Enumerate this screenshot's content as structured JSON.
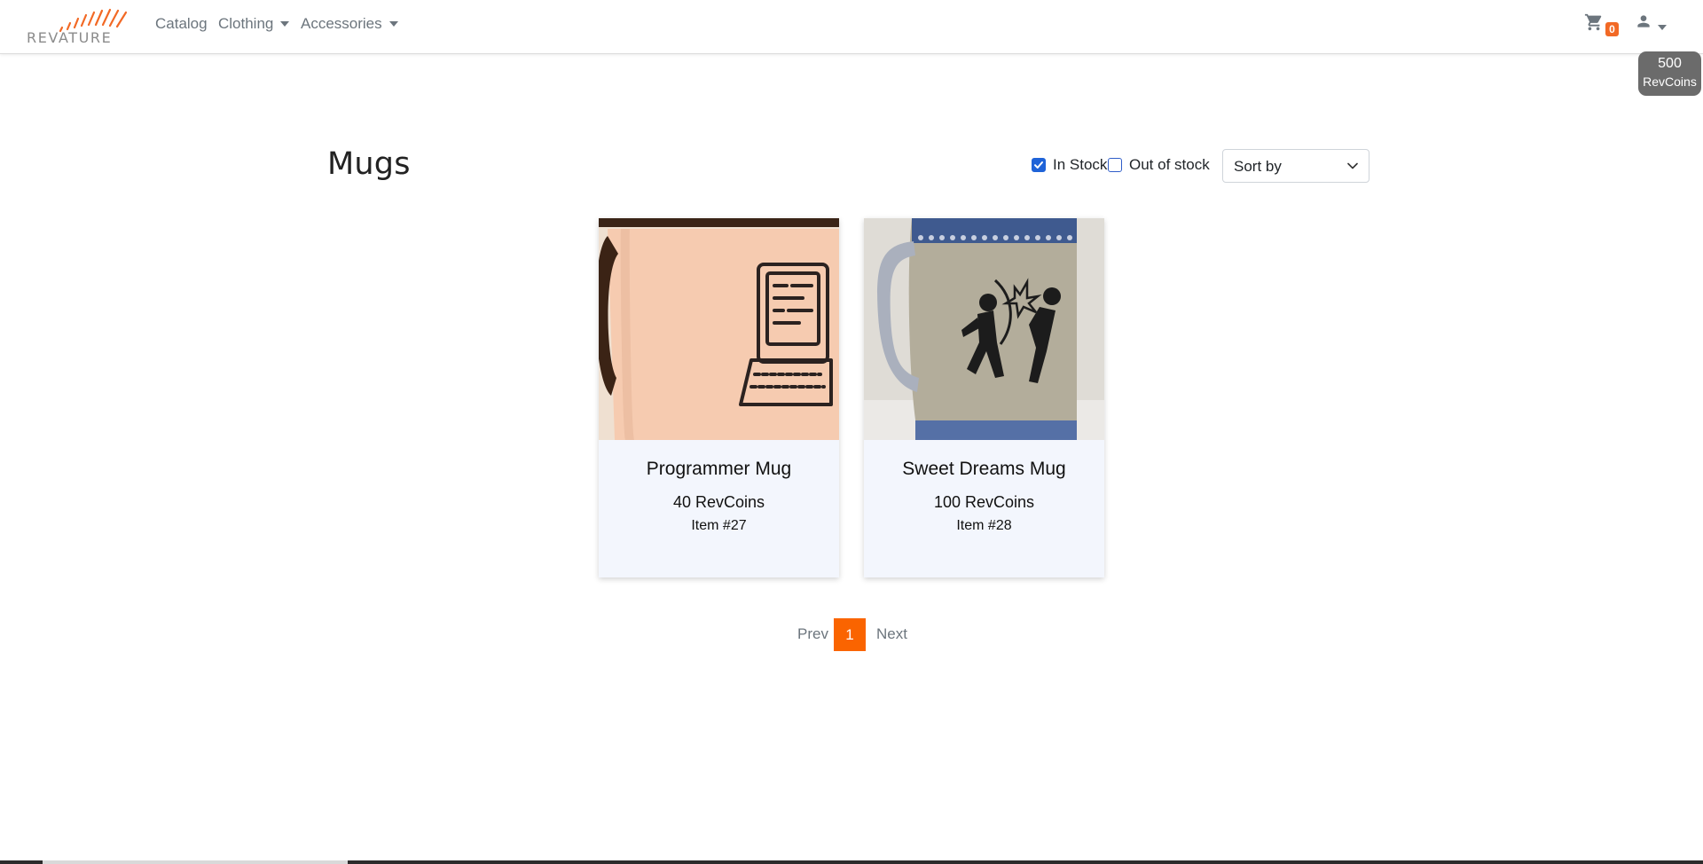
{
  "navbar": {
    "brand": "REVATURE",
    "links": [
      {
        "label": "Catalog"
      },
      {
        "label": "Clothing"
      },
      {
        "label": "Accessories"
      }
    ],
    "cart_count": "0",
    "icons": [
      "cart-icon",
      "user-icon",
      "chevron-down-icon"
    ]
  },
  "wallet": {
    "amount": "500",
    "unit": "RevCoins"
  },
  "page": {
    "title": "Mugs"
  },
  "filters": {
    "in_stock": {
      "label": "In Stock",
      "checked": true
    },
    "out_of_stock": {
      "label": "Out of stock",
      "checked": false
    },
    "sort": {
      "value": "Sort by"
    }
  },
  "products": [
    {
      "name": "Programmer Mug",
      "price": "40 RevCoins",
      "item": "Item #27"
    },
    {
      "name": "Sweet Dreams Mug",
      "price": "100 RevCoins",
      "item": "Item #28"
    }
  ],
  "pagination": {
    "prev": "Prev",
    "current": "1",
    "next": "Next"
  },
  "colors": {
    "accent": "#fa6400",
    "card_bg": "#f3f6fd",
    "checkbox": "#1f63d8"
  }
}
